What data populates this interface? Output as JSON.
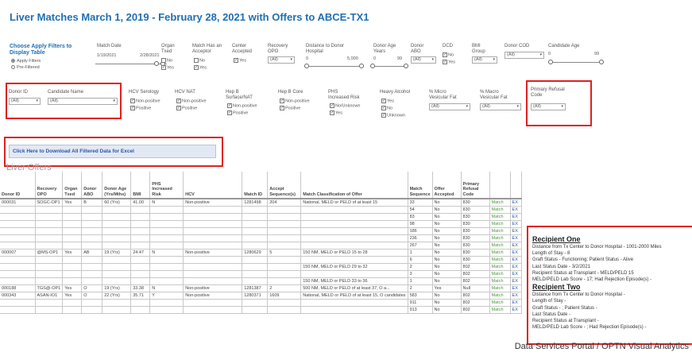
{
  "title": "Liver Matches March 1, 2019 - February 28, 2021 with Offers to ABCE-TX1",
  "filters_row1": {
    "choose_label": "Choose Apply Filters to Display Table",
    "radio_apply": "Apply Filters",
    "radio_prefiltered": "Pre-Filtered",
    "match_date": {
      "label": "Match Date",
      "from": "1/19/2021",
      "to": "2/28/2021"
    },
    "organ_txed": {
      "label": "Organ Txed",
      "opt_no": "No",
      "opt_yes": "Yes"
    },
    "match_has_acceptor": {
      "label": "Match Has an Acceptor",
      "opt_no": "No",
      "opt_yes": "Yes"
    },
    "center_accepted": {
      "label": "Center Accepted",
      "opt_yes": "Yes"
    },
    "recovery_opo": {
      "label": "Recovery OPO",
      "value": "(All)"
    },
    "distance": {
      "label": "Distance to Donor Hospital",
      "min": "0",
      "max": "5,000"
    },
    "donor_age": {
      "label": "Donor Age Years",
      "min": "0",
      "max": "99"
    },
    "donor_abo": {
      "label": "Donor ABO",
      "value": "(All)"
    },
    "dcd": {
      "label": "DCD",
      "opt_no": "No",
      "opt_yes": "Yes"
    },
    "bmi_group": {
      "label": "BMI Group",
      "value": "(All)"
    },
    "donor_cod": {
      "label": "Donor COD",
      "value": "(All)"
    },
    "candidate_age": {
      "label": "Candidate Age",
      "min": "0",
      "max": "99"
    }
  },
  "filters_row2": {
    "donor_id": {
      "label": "Donor ID",
      "value": "(All)"
    },
    "candidate_name": {
      "label": "Candidate Name",
      "value": "(All)"
    },
    "hcv_serology": {
      "label": "HCV Serology",
      "opt1": "Non-positive",
      "opt2": "Positive"
    },
    "hcv_nat": {
      "label": "HCV NAT",
      "opt1": "Non-positive",
      "opt2": "Positive"
    },
    "hep_b_surface": {
      "label": "Hep B Surface/NAT",
      "opt1": "Non-positive",
      "opt2": "Positive"
    },
    "hep_b_core": {
      "label": "Hep B Core",
      "opt1": "Non-positive",
      "opt2": "Positive"
    },
    "phs_risk": {
      "label": "PHS Increased Risk",
      "opt1": "No/Unknown",
      "opt2": "Yes"
    },
    "heavy_alcohol": {
      "label": "Heavy Alcohol",
      "opt1": "Yes",
      "opt2": "No",
      "opt3": "Unknown"
    },
    "micro_fat": {
      "label": "% Micro Vesicular Fat",
      "value": "(All)"
    },
    "macro_fat": {
      "label": "% Macro Vesicular Fat",
      "value": "(All)"
    },
    "refusal_code": {
      "label": "Primary Refusal Code",
      "value": "(All)"
    }
  },
  "download_label": "Click Here to Download All Filtered Data for Excel",
  "section_title": "Liver Offers",
  "table": {
    "headers": [
      "Donor ID",
      "Recovery OPO",
      "Organ Txed",
      "Donor ABO",
      "Donor Age (Yrs/Mths)",
      "BMI",
      "PHS Increased Risk",
      "HCV",
      "Match ID",
      "Accept Sequence(s)",
      "Match Classification of Offer",
      "Match Sequence",
      "Offer Accepted",
      "Primary Refusal Code",
      "",
      ""
    ],
    "rows": [
      [
        "000031",
        "SOGC-OP1",
        "Yes",
        "B",
        "60 (Yrs)",
        "41.00",
        "N",
        "Non-positive",
        "1281498",
        "204",
        "National, MELD or PELD of at least 15",
        "33",
        "No",
        "830",
        "Match",
        "EX"
      ],
      [
        "",
        "",
        "",
        "",
        "",
        "",
        "",
        "",
        "",
        "",
        "",
        "54",
        "No",
        "830",
        "Match",
        "EX"
      ],
      [
        "",
        "",
        "",
        "",
        "",
        "",
        "",
        "",
        "",
        "",
        "",
        "83",
        "No",
        "830",
        "Match",
        "EX"
      ],
      [
        "",
        "",
        "",
        "",
        "",
        "",
        "",
        "",
        "",
        "",
        "",
        "98",
        "No",
        "830",
        "Match",
        "EX"
      ],
      [
        "",
        "",
        "",
        "",
        "",
        "",
        "",
        "",
        "",
        "",
        "",
        "186",
        "No",
        "830",
        "Match",
        "EX"
      ],
      [
        "",
        "",
        "",
        "",
        "",
        "",
        "",
        "",
        "",
        "",
        "",
        "236",
        "No",
        "830",
        "Match",
        "EX"
      ],
      [
        "",
        "",
        "",
        "",
        "",
        "",
        "",
        "",
        "",
        "",
        "",
        "267",
        "No",
        "830",
        "Match",
        "EX"
      ],
      [
        "000007",
        "@MS-OP1",
        "Yes",
        "AB",
        "19 (Yrs)",
        "24.47",
        "N",
        "Non-positive",
        "1280629",
        "5",
        "150 NM, MELD or PELD 15 to 28",
        "1",
        "No",
        "830",
        "Match",
        "EX"
      ],
      [
        "",
        "",
        "",
        "",
        "",
        "",
        "",
        "",
        "",
        "",
        "",
        "6",
        "No",
        "830",
        "Match",
        "EX"
      ],
      [
        "",
        "",
        "",
        "",
        "",
        "",
        "",
        "",
        "",
        "",
        "150 NM, MELD or PELD 29 to 32",
        "2",
        "No",
        "802",
        "Match",
        "EX"
      ],
      [
        "",
        "",
        "",
        "",
        "",
        "",
        "",
        "",
        "",
        "",
        "",
        "3",
        "No",
        "802",
        "Match",
        "EX"
      ],
      [
        "",
        "",
        "",
        "",
        "",
        "",
        "",
        "",
        "",
        "",
        "150 NM, MELD or PELD 33 to 36",
        "1",
        "No",
        "802",
        "Match",
        "EX"
      ],
      [
        "000188",
        "TGS@-OP1",
        "Yes",
        "O",
        "19 (Yrs)",
        "33.38",
        "N",
        "Non-positive",
        "1281387",
        "2",
        "500 NM, MELD or PELD of at least 37, O a...",
        "2",
        "Yes",
        "Null",
        "Match",
        "EX"
      ],
      [
        "000343",
        "ASAN-IO1",
        "Yes",
        "O",
        "22 (Yrs)",
        "35.71",
        "Y",
        "Non-positive",
        "1280371",
        "1609",
        "National, MELD or PELD of at least 15, O candidates",
        "583",
        "No",
        "802",
        "Match",
        "EX"
      ],
      [
        "",
        "",
        "",
        "",
        "",
        "",
        "",
        "",
        "",
        "",
        "",
        "911",
        "No",
        "802",
        "Match",
        "EX"
      ],
      [
        "",
        "",
        "",
        "",
        "",
        "",
        "",
        "",
        "",
        "",
        "",
        "913",
        "No",
        "802",
        "Match",
        "EX"
      ]
    ]
  },
  "popup": {
    "r1_title": "Recipient One",
    "r1_l1": "Distance from Tx Center to Donor Hospital - 1001-2000 Miles",
    "r1_l2": "Length of Stay - 8",
    "r1_l3": "Graft Status - Functioning; Patient Status - Alive",
    "r1_l4": "Last Status Date - 3/2/2021",
    "r1_l5": "Recipient Status at Transplant - MELD/PELD 15",
    "r1_l6": "MELD/PELD Lab Score - 17; Had Rejection Episode(s) -",
    "r2_title": "Recipient Two",
    "r2_l1": "Distance from Tx Center to Donor Hospital -",
    "r2_l2": "Length of Stay -",
    "r2_l3": "Graft Status - ; Patient Status -",
    "r2_l4": "Last Status Date -",
    "r2_l5": "Recipient Status at Transplant -",
    "r2_l6": "MELD/PELD Lab Score - ; Had Rejection Episode(s) -"
  },
  "footer": "Data Services Portal / OPTN Visual Analytics",
  "colors": {
    "title": "#1f6fb3",
    "highlight_box": "#e02020",
    "match_link": "#4a9a3a",
    "ex_link": "#2a56a8"
  }
}
